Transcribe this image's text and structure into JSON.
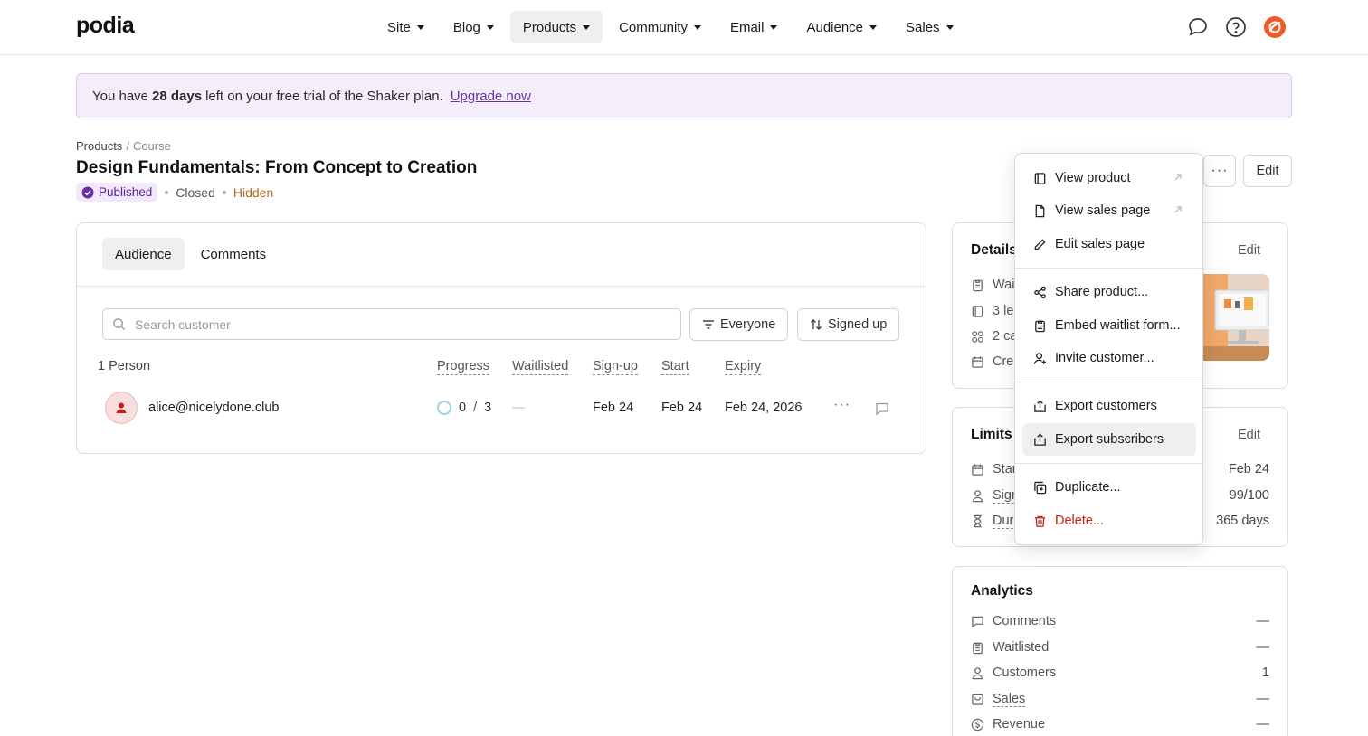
{
  "brand": {
    "logo": "podia"
  },
  "nav": {
    "items": [
      {
        "label": "Site"
      },
      {
        "label": "Blog"
      },
      {
        "label": "Products"
      },
      {
        "label": "Community"
      },
      {
        "label": "Email"
      },
      {
        "label": "Audience"
      },
      {
        "label": "Sales"
      }
    ],
    "active": "Products",
    "icons": [
      "chat-icon",
      "help-icon",
      "user-profile-icon"
    ]
  },
  "banner": {
    "prefix": "You have",
    "days": "28 days",
    "suffix": "left on your free trial of the Shaker plan.",
    "link": "Upgrade now"
  },
  "breadcrumb": {
    "parent": "Products",
    "sep": "/",
    "current": "Course"
  },
  "product": {
    "title": "Design Fundamentals: From Concept to Creation",
    "status_published": "Published",
    "status_closed": "Closed",
    "status_hidden": "Hidden"
  },
  "header_buttons": {
    "more": "···",
    "edit": "Edit"
  },
  "tabs": [
    {
      "label": "Audience"
    },
    {
      "label": "Comments"
    }
  ],
  "search": {
    "placeholder": "Search customer",
    "value": ""
  },
  "filters": {
    "audience": "Everyone",
    "sort": "Signed up"
  },
  "table": {
    "count": "1 Person",
    "headers": {
      "progress": "Progress",
      "waitlisted": "Waitlisted",
      "signup": "Sign-up",
      "start": "Start",
      "expiry": "Expiry"
    },
    "rows": [
      {
        "email": "alice@nicelydone.club",
        "progress_done": "0",
        "progress_sep": "/",
        "progress_total": "3",
        "waitlisted": "—",
        "signup": "Feb 24",
        "start": "Feb 24",
        "expiry": "Feb 24, 2026",
        "more": "···"
      }
    ]
  },
  "details_card": {
    "title": "Details",
    "edit": "Edit",
    "lines": [
      "Wai",
      "3 le",
      "2 ca",
      "Cre"
    ]
  },
  "limits_card": {
    "title": "Limits",
    "edit": "Edit",
    "lines": [
      {
        "label": "Star",
        "value": "Feb 24"
      },
      {
        "label": "Sign",
        "value": "99/100"
      },
      {
        "label": "Dur",
        "value": "365 days"
      }
    ]
  },
  "analytics_card": {
    "title": "Analytics",
    "lines": [
      {
        "label": "Comments",
        "value": "—"
      },
      {
        "label": "Waitlisted",
        "value": "—"
      },
      {
        "label": "Customers",
        "value": "1"
      },
      {
        "label": "Sales",
        "value": "—"
      },
      {
        "label": "Revenue",
        "value": "—"
      }
    ]
  },
  "menu": {
    "items": [
      {
        "label": "View product",
        "icon": "book-icon",
        "external": true
      },
      {
        "label": "View sales page",
        "icon": "page-icon",
        "external": true
      },
      {
        "label": "Edit sales page",
        "icon": "pencil-icon"
      },
      {
        "label": "Share product...",
        "icon": "share-icon"
      },
      {
        "label": "Embed waitlist form...",
        "icon": "clipboard-icon"
      },
      {
        "label": "Invite customer...",
        "icon": "user-add-icon"
      },
      {
        "label": "Export customers",
        "icon": "export-icon"
      },
      {
        "label": "Export subscribers",
        "icon": "export-icon",
        "highlighted": true
      },
      {
        "label": "Duplicate...",
        "icon": "duplicate-icon"
      },
      {
        "label": "Delete...",
        "icon": "trash-icon",
        "danger": true
      }
    ]
  },
  "colors": {
    "accent": "#6b2fa6",
    "danger": "#c0201a",
    "hidden": "#b36b1f",
    "banner_bg": "#f3eefa"
  }
}
